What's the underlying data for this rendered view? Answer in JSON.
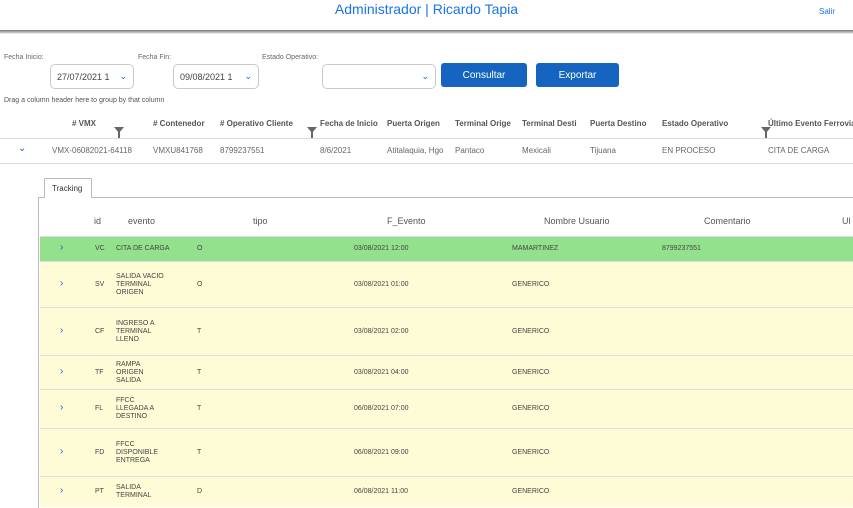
{
  "header": {
    "title": "Administrador | Ricardo Tapia",
    "logout": "Salir"
  },
  "filters": {
    "start_label": "Fecha Inicio:",
    "start_value": "27/07/2021 1",
    "end_label": "Fecha Fin:",
    "end_value": "09/08/2021 1",
    "state_label": "Estado Operativo:",
    "state_value": "",
    "consult_label": "Consultar",
    "export_label": "Exportar"
  },
  "grid": {
    "group_hint": "Drag a column header here to group by that column",
    "columns": [
      "# VMX",
      "# Contenedor",
      "# Operativo Cliente",
      "Fecha de Inicio",
      "Puerta Origen",
      "Terminal Orige",
      "Terminal Desti",
      "Puerta Destino",
      "Estado Operativo",
      "Último Evento Ferrovia"
    ],
    "row": {
      "vmx": "VMX-06082021-64118",
      "contenedor": "VMXU841768",
      "operativo": "8799237551",
      "fecha": "8/6/2021",
      "puerta_origen": "Atitalaquia, Hgo",
      "terminal_origen": "Pantaco",
      "terminal_destino": "Mexicali",
      "puerta_destino": "Tijuana",
      "estado": "EN PROCESO",
      "ultimo_evento": "CITA DE CARGA"
    }
  },
  "tracking": {
    "tab_label": "Tracking",
    "columns": [
      "id",
      "evento",
      "tipo",
      "F_Evento",
      "Nombre Usuario",
      "Comentario",
      "Ul"
    ],
    "rows": [
      {
        "id": "VC",
        "evento": "CITA DE CARGA",
        "tipo": "O",
        "fecha": "03/08/2021 12:00",
        "usuario": "MAMARTINEZ",
        "comentario": "8799237551"
      },
      {
        "id": "SV",
        "evento": "SALIDA VACIO TERMINAL ORIGEN",
        "tipo": "O",
        "fecha": "03/08/2021 01:00",
        "usuario": "GENERICO",
        "comentario": ""
      },
      {
        "id": "CF",
        "evento": "INGRESO A TERMINAL LLENO",
        "tipo": "T",
        "fecha": "03/08/2021 02:00",
        "usuario": "GENERICO",
        "comentario": ""
      },
      {
        "id": "TF",
        "evento": "RAMPA ORIGEN SALIDA",
        "tipo": "T",
        "fecha": "03/08/2021 04:00",
        "usuario": "GENERICO",
        "comentario": ""
      },
      {
        "id": "FL",
        "evento": "FFCC LLEGADA A DESTINO",
        "tipo": "T",
        "fecha": "06/08/2021 07:00",
        "usuario": "GENERICO",
        "comentario": ""
      },
      {
        "id": "FD",
        "evento": "FFCC DISPONIBLE ENTREGA",
        "tipo": "T",
        "fecha": "06/08/2021 09:00",
        "usuario": "GENERICO",
        "comentario": ""
      },
      {
        "id": "PT",
        "evento": "SALIDA TERMINAL",
        "tipo": "D",
        "fecha": "06/08/2021 11:00",
        "usuario": "GENERICO",
        "comentario": ""
      }
    ]
  },
  "colors": {
    "accent": "#1565c0",
    "highlight_row": "#93e08d",
    "row_bg": "#fefcd6"
  }
}
